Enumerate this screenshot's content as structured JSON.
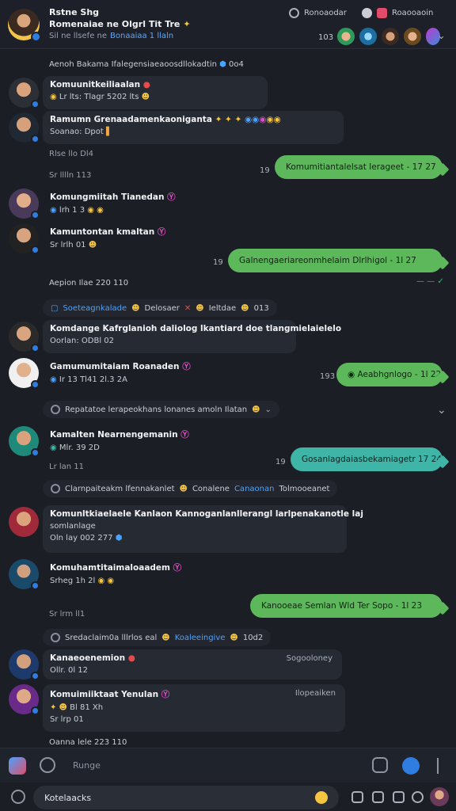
{
  "header": {
    "title": "Rstne Shg",
    "subtitle": "Romenaiae ne Olgrl Tit Tre",
    "meta": "Sil ne llsefe ne",
    "meta_link": "Bonaaiaa 1 llaln",
    "pill1": "Ronoaodar",
    "pill2": "Roaooaoin",
    "member_count": "103"
  },
  "messages": [
    {
      "name": "Komuunitkeiliaalan",
      "line2": "Lr lts: Tlagr 5202 lts",
      "ts": "Sr lllln 113"
    },
    {
      "name": "Ramumn Grenaadamenkaoniganta",
      "line2": "Soanao: Dpot",
      "ts": "Rlse llo Dl4"
    },
    {
      "out": "Komumitiantalelsat Ierageet - 17 27",
      "num": "19"
    },
    {
      "name": "Komungmiitah Tianedan",
      "line2": "lrh 1 3",
      "ts": ""
    },
    {
      "name": "Kamuntontan kmaltan",
      "line2": "Sr lrlh 01",
      "ts": ""
    },
    {
      "out": "Galnengaeriareonmhelaim Dlrlhigol - 1l 27",
      "num": "19"
    },
    {
      "plain": "Aepion Ilae 220 110"
    },
    {
      "sys": "Soeteagnkalade",
      "sys2": "Delosaer",
      "sys3": "Ieltdae",
      "sys4": "013"
    },
    {
      "name": "Komdange Kafrglanioh daliolog lkantiard doe tlangmielaielelo",
      "line2": "Oorlan: ODBl 02"
    },
    {
      "name": "Gamumumitaiam Roanaden",
      "line2": "Ir 13 Tl41 2l.3 2A",
      "out": "Aeabhgnlogo - 1l 22",
      "num": "193"
    },
    {
      "plain": "Repatatoe lerapeokhans lonanes amoln Ilatan"
    },
    {
      "name": "Kamalten Nearnengemanin",
      "line2": "Mlr. 39 2D",
      "ts": "Lr lan 11",
      "out": "Gosanlagdaiasbekamiagetr 17 24",
      "num": "19"
    },
    {
      "sys": "Clarnpaiteakm lfennakanlet",
      "sys2": "Conalene",
      "sys3": "Canaonan",
      "sys4": "Tolmooeanet"
    },
    {
      "name": "Komunltkiaelaele Kanlaon Kannoganlanllerangl larlpenakanotle laj",
      "line2": "somlanlage",
      "ts": "Oln lay 002 277"
    },
    {
      "name": "Komuhamtitaimaloaadem",
      "line2": "Srheg 1h 2l",
      "ts": "Sr lrm ll1",
      "out": "Kanooeae Semlan Wld Ter Sopo - 1l 23"
    },
    {
      "sys": "Sredaclaim0a lllrlos eal",
      "sys2": "Koaleeingive",
      "sys3": "10d2"
    },
    {
      "name": "Kanaeoenemion",
      "line2": "Ollr. 0l 12",
      "rtime": "Sogooloney"
    },
    {
      "name": "Komuimiiktaat Yenulan",
      "line2": "Bl 81 Xh",
      "ts": "Sr lrp 01",
      "rtime": "Ilopeaiken"
    },
    {
      "plain": "Oanna lele 223 110"
    }
  ],
  "composer": {
    "top_label": "Runge",
    "input_value": "Kotelaacks"
  }
}
